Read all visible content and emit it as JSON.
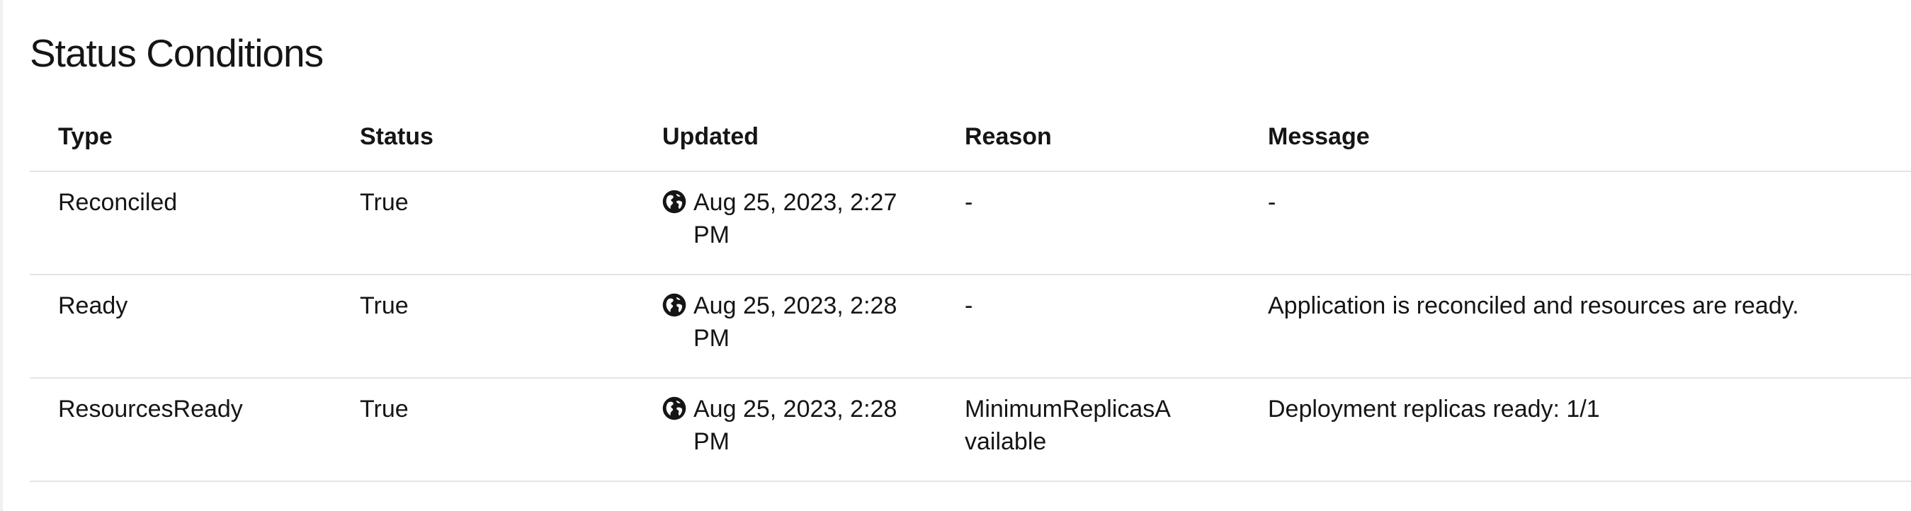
{
  "section": {
    "title": "Status Conditions"
  },
  "table": {
    "headers": {
      "type": "Type",
      "status": "Status",
      "updated": "Updated",
      "reason": "Reason",
      "message": "Message"
    },
    "rows": [
      {
        "type": "Reconciled",
        "status": "True",
        "updated": "Aug 25, 2023, 2:27 PM",
        "reason": "-",
        "message": "-"
      },
      {
        "type": "Ready",
        "status": "True",
        "updated": "Aug 25, 2023, 2:28 PM",
        "reason": "-",
        "message": "Application is reconciled and resources are ready."
      },
      {
        "type": "ResourcesReady",
        "status": "True",
        "updated": "Aug 25, 2023, 2:28 PM",
        "reason": "MinimumReplicasAvailable",
        "message": "Deployment replicas ready: 1/1"
      }
    ]
  },
  "icons": {
    "timestamp": "globe-icon"
  },
  "colors": {
    "text": "#151515",
    "divider": "#e4e4e4",
    "background": "#ffffff"
  }
}
